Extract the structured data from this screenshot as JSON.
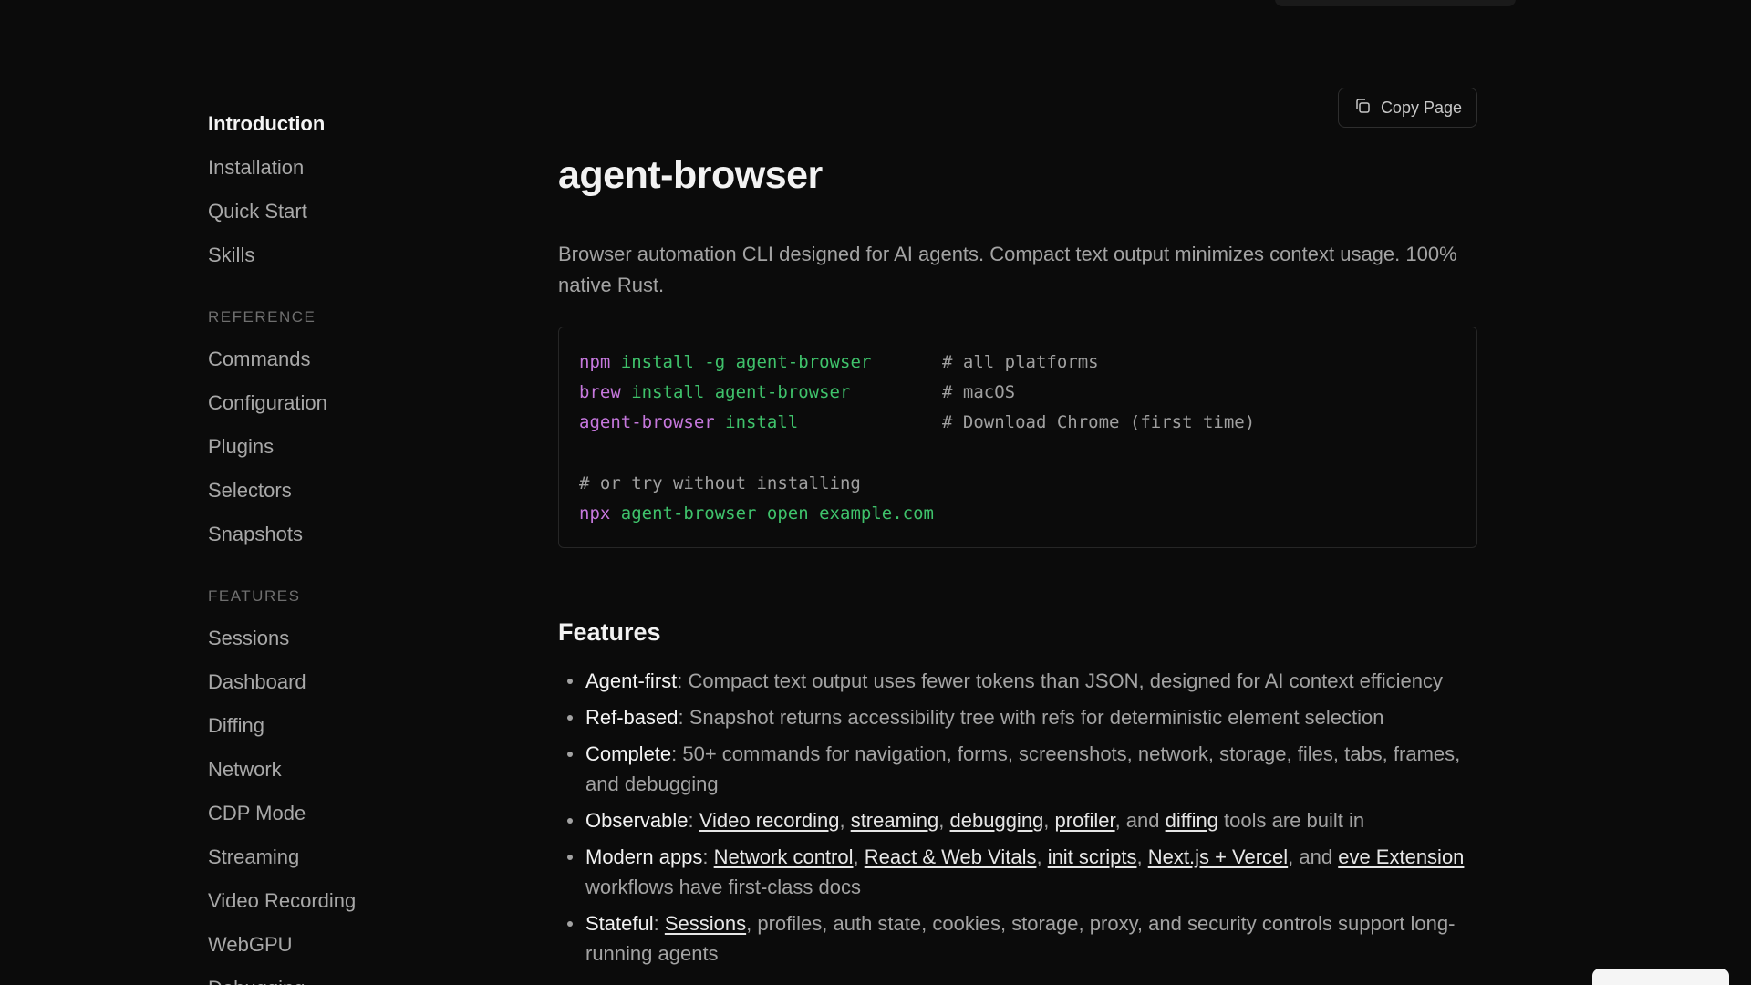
{
  "sidebar": {
    "top_items": [
      {
        "label": "Introduction",
        "active": true
      },
      {
        "label": "Installation"
      },
      {
        "label": "Quick Start"
      },
      {
        "label": "Skills"
      }
    ],
    "sections": [
      {
        "title": "REFERENCE",
        "items": [
          "Commands",
          "Configuration",
          "Plugins",
          "Selectors",
          "Snapshots"
        ]
      },
      {
        "title": "FEATURES",
        "items": [
          "Sessions",
          "Dashboard",
          "Diffing",
          "Network",
          "CDP Mode",
          "Streaming",
          "Video Recording",
          "WebGPU",
          "Debugging"
        ]
      }
    ]
  },
  "header": {
    "copy_label": "Copy Page",
    "copy_icon": "copy-icon"
  },
  "main": {
    "title": "agent-browser",
    "intro": "Browser automation CLI designed for AI agents. Compact text output minimizes context usage. 100% native Rust.",
    "code": {
      "lines": [
        {
          "cmd": "npm",
          "args": "install -g agent-browser",
          "comment": "# all platforms"
        },
        {
          "cmd": "brew",
          "args": "install agent-browser",
          "comment": "# macOS"
        },
        {
          "cmd": "agent-browser",
          "args": "install",
          "comment": "# Download Chrome (first time)"
        }
      ],
      "comment_line": "# or try without installing",
      "last_line": {
        "cmd": "npx",
        "args": "agent-browser open example.com"
      }
    },
    "features_title": "Features",
    "features": [
      {
        "name": "Agent-first",
        "segments": [
          {
            "text": ": Compact text output uses fewer tokens than JSON, designed for AI context efficiency"
          }
        ]
      },
      {
        "name": "Ref-based",
        "segments": [
          {
            "text": ": Snapshot returns accessibility tree with refs for deterministic element selection"
          }
        ]
      },
      {
        "name": "Complete",
        "segments": [
          {
            "text": ": 50+ commands for navigation, forms, screenshots, network, storage, files, tabs, frames, and debugging"
          }
        ]
      },
      {
        "name": "Observable",
        "segments": [
          {
            "text": ": "
          },
          {
            "link": "Video recording"
          },
          {
            "text": ", "
          },
          {
            "link": "streaming"
          },
          {
            "text": ", "
          },
          {
            "link": "debugging"
          },
          {
            "text": ", "
          },
          {
            "link": "profiler"
          },
          {
            "text": ", and "
          },
          {
            "link": "diffing"
          },
          {
            "text": " tools are built in"
          }
        ]
      },
      {
        "name": "Modern apps",
        "segments": [
          {
            "text": ": "
          },
          {
            "link": "Network control"
          },
          {
            "text": ", "
          },
          {
            "link": "React & Web Vitals"
          },
          {
            "text": ", "
          },
          {
            "link": "init scripts"
          },
          {
            "text": ", "
          },
          {
            "link": "Next.js + Vercel"
          },
          {
            "text": ", and "
          },
          {
            "link": "eve Extension"
          },
          {
            "text": " workflows have first-class docs"
          }
        ]
      },
      {
        "name": "Stateful",
        "segments": [
          {
            "text": ": "
          },
          {
            "link": "Sessions"
          },
          {
            "text": ", profiles, auth state, cookies, storage, proxy, and security controls support long-running agents"
          }
        ]
      }
    ]
  },
  "colors": {
    "background": "#0b0b0b",
    "command": "#c678dd",
    "argument": "#3fc26b"
  }
}
